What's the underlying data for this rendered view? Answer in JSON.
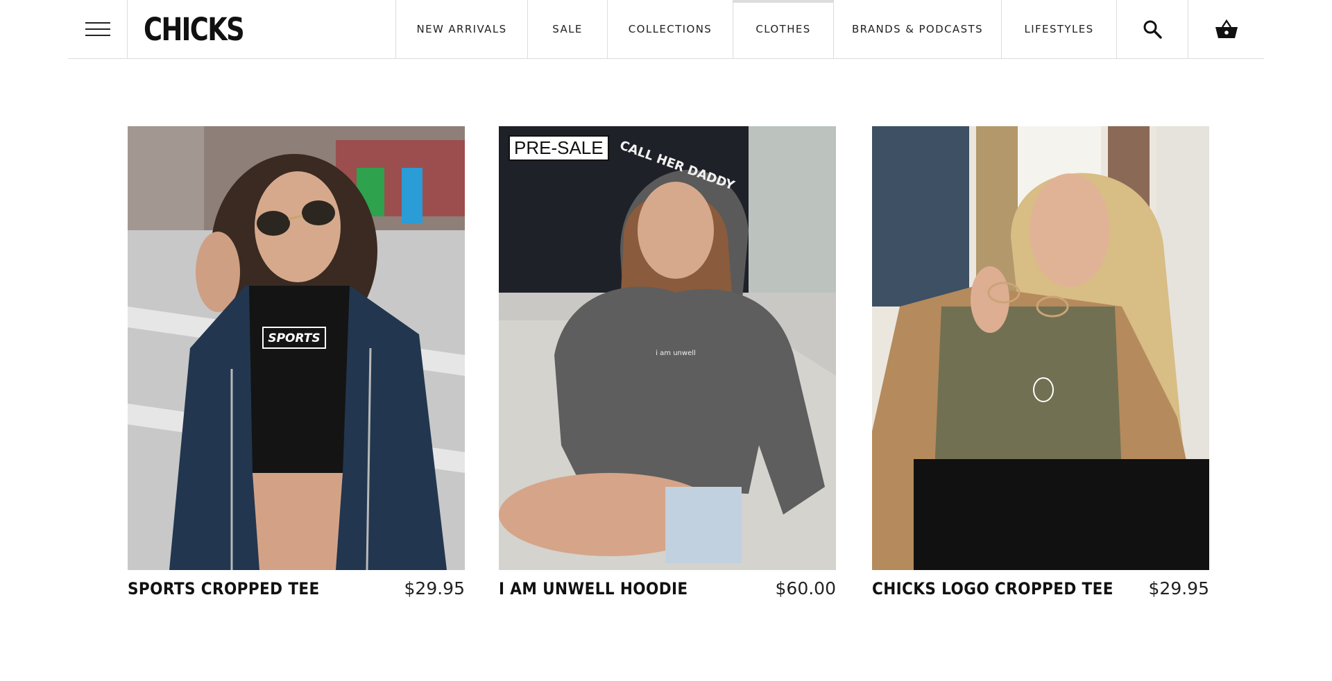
{
  "header": {
    "logo": "CHICKS",
    "nav": [
      "NEW ARRIVALS",
      "SALE",
      "COLLECTIONS",
      "CLOTHES",
      "BRANDS & PODCASTS",
      "LIFESTYLES"
    ],
    "active_nav": "CLOTHES"
  },
  "icons": {
    "menu": "hamburger-menu-icon",
    "search": "search-icon",
    "cart": "basket-icon"
  },
  "products": [
    {
      "name": "SPORTS CROPPED TEE",
      "price": "$29.95",
      "badge": "",
      "tee_text": "SPORTS"
    },
    {
      "name": "I AM UNWELL HOODIE",
      "price": "$60.00",
      "badge": "PRE-SALE",
      "hood_text": "CALL HER DADDY",
      "chest_text": "i am unwell"
    },
    {
      "name": "CHICKS LOGO CROPPED TEE",
      "price": "$29.95",
      "badge": ""
    }
  ],
  "colors": {
    "border": "#dcdcdc",
    "text": "#111111",
    "background": "#ffffff"
  }
}
